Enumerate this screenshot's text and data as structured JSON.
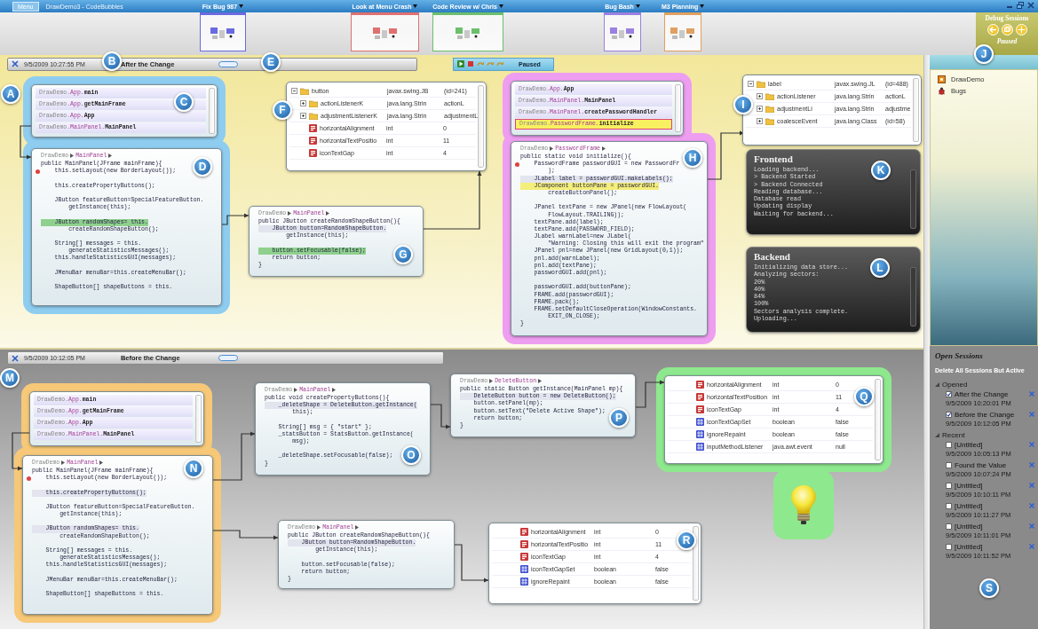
{
  "title_bar": {
    "menu_label": "Menu",
    "title": "DrawDemo3 - CodeBubbles"
  },
  "working_sets": [
    {
      "label": "Fix Bug 987",
      "color": "#6a6ae0"
    },
    {
      "label": "Look at Menu Crash",
      "color": "#e07070"
    },
    {
      "label": "Code Review w/ Chris",
      "color": "#6cbf6c"
    },
    {
      "label": "Bug Bash",
      "color": "#9a80e0"
    },
    {
      "label": "M3 Planning",
      "color": "#e0a060"
    }
  ],
  "debug_sessions": {
    "title": "Debug Sessions",
    "status": "Paused",
    "marker": "J"
  },
  "workspaces": [
    {
      "marker": "A",
      "session": {
        "date": "9/5/2009 10:27:55 PM",
        "title": "After the Change",
        "marker": "B",
        "handle_marker": "E"
      },
      "debug_toolbar": {
        "status": "Paused"
      },
      "groups": [
        {
          "color": "#8ecdf0",
          "bubbles": [
            {
              "kind": "stack",
              "marker": "C",
              "frames": [
                {
                  "package": "DrawDemo.",
                  "class": "App.",
                  "method": "main",
                  "selected": false
                },
                {
                  "package": "DrawDemo.",
                  "class": "App.",
                  "method": "getMainFrame",
                  "selected": false
                },
                {
                  "package": "DrawDemo.",
                  "class": "App.",
                  "method": "App",
                  "selected": false
                },
                {
                  "package": "DrawDemo.",
                  "class": "MainPanel.",
                  "method": "MainPanel",
                  "selected": false
                }
              ]
            },
            {
              "kind": "code",
              "marker": "D",
              "path": [
                "DrawDemo",
                "MainPanel"
              ],
              "blocks": [
                [
                  {
                    "text": "public MainPanel(JFrame mainFrame){",
                    "kind": "plain"
                  },
                  {
                    "text": "    this.setLayout(new BorderLayout());",
                    "kind": "breakpoint"
                  }
                ],
                [
                  {
                    "text": "    this.createPropertyButtons();",
                    "kind": "plain"
                  }
                ],
                [
                  {
                    "text": "    JButton featureButton=SpecialFeatureButton.",
                    "kind": "plain"
                  },
                  {
                    "text": "        getInstance(this);",
                    "kind": "plain"
                  }
                ],
                [
                  {
                    "text": "    JButton randomShapes= this.",
                    "kind": "current"
                  },
                  {
                    "text": "        createRandomShapeButton();",
                    "kind": "plain"
                  }
                ],
                [
                  {
                    "text": "    String[] messages = this.",
                    "kind": "plain"
                  },
                  {
                    "text": "        generateStatisticsMessages();",
                    "kind": "plain"
                  },
                  {
                    "text": "    this.handleStatisticsGUI(messages);",
                    "kind": "plain"
                  }
                ],
                [
                  {
                    "text": "    JMenuBar menuBar=this.createMenuBar();",
                    "kind": "plain"
                  }
                ],
                [
                  {
                    "text": "    ShapeButton[] shapeButtons = this.",
                    "kind": "plain"
                  }
                ]
              ]
            }
          ]
        },
        {
          "color": "#ee9ef0",
          "bubbles": [
            {
              "kind": "stack",
              "frames": [
                {
                  "package": "DrawDemo.",
                  "class": "App.",
                  "method": "App",
                  "selected": false
                },
                {
                  "package": "DrawDemo.",
                  "class": "MainPanel.",
                  "method": "MainPanel",
                  "selected": false
                },
                {
                  "package": "DrawDemo.",
                  "class": "MainPanel.",
                  "method": "createPasswordHandler",
                  "selected": false
                },
                {
                  "package": "DrawDemo.",
                  "class": "PasswordFrame.",
                  "method": "initialize",
                  "selected": true
                }
              ]
            },
            {
              "kind": "code",
              "marker": "H",
              "path": [
                "DrawDemo",
                "PasswordFrame"
              ],
              "blocks": [
                [
                  {
                    "text": "public static void initialize(){",
                    "kind": "plain"
                  },
                  {
                    "text": "    PasswordFrame passwordGUI = new PasswordFr",
                    "kind": "breakpoint"
                  },
                  {
                    "text": "        );",
                    "kind": "plain"
                  },
                  {
                    "text": "    JLabel label = passwordGUI.makeLabels();",
                    "kind": "hover"
                  },
                  {
                    "text": "    JComponent buttonPane = passwordGUI.",
                    "kind": "caller"
                  },
                  {
                    "text": "        createButtonPanel();",
                    "kind": "plain"
                  }
                ],
                [
                  {
                    "text": "    JPanel textPane = new JPanel(new FlowLayout(",
                    "kind": "plain"
                  },
                  {
                    "text": "        FlowLayout.TRAILING));",
                    "kind": "plain"
                  },
                  {
                    "text": "    textPane.add(label);",
                    "kind": "plain"
                  },
                  {
                    "text": "    textPane.add(PASSWORD_FIELD);",
                    "kind": "plain"
                  },
                  {
                    "text": "    JLabel warnLabel=new JLabel(",
                    "kind": "plain"
                  },
                  {
                    "text": "        \"Warning: Closing this will exit the program\"",
                    "kind": "plain"
                  },
                  {
                    "text": "    JPanel pnl=new JPanel(new GridLayout(0,1));",
                    "kind": "plain"
                  },
                  {
                    "text": "    pnl.add(warnLabel);",
                    "kind": "plain"
                  },
                  {
                    "text": "    pnl.add(textPane);",
                    "kind": "plain"
                  },
                  {
                    "text": "    passwordGUI.add(pnl);",
                    "kind": "plain"
                  }
                ],
                [
                  {
                    "text": "    passwordGUI.add(buttonPane);",
                    "kind": "plain"
                  },
                  {
                    "text": "    FRAME.add(passwordGUI);",
                    "kind": "plain"
                  },
                  {
                    "text": "    FRAME.pack();",
                    "kind": "plain"
                  },
                  {
                    "text": "    FRAME.setDefaultCloseOperation(WindowConstants.",
                    "kind": "plain"
                  },
                  {
                    "text": "        EXIT_ON_CLOSE);",
                    "kind": "plain"
                  },
                  {
                    "text": "}",
                    "kind": "plain"
                  }
                ]
              ]
            }
          ]
        }
      ],
      "bubbles": [
        {
          "kind": "variables",
          "marker": "F",
          "rows": [
            {
              "kind": "object",
              "name": "button",
              "type": "javax.swing.JB",
              "value": "(id=241)",
              "expanded": true,
              "children": [
                {
                  "kind": "object",
                  "name": "actionListenerK",
                  "type": "java.lang.Strin",
                  "value": "actionL",
                  "expanded": false
                },
                {
                  "kind": "object",
                  "name": "adjustmentListenerK",
                  "type": "java.lang.Strin",
                  "value": "adjustmentL",
                  "expanded": false
                },
                {
                  "kind": "int",
                  "name": "horizontalAlignment",
                  "type": "int",
                  "value": "0"
                },
                {
                  "kind": "int",
                  "name": "horizontalTextPositio",
                  "type": "int",
                  "value": "11"
                },
                {
                  "kind": "int",
                  "name": "iconTextGap",
                  "type": "int",
                  "value": "4"
                }
              ]
            }
          ]
        },
        {
          "kind": "code",
          "marker": "G",
          "path": [
            "DrawDemo",
            "MainPanel"
          ],
          "blocks": [
            [
              {
                "text": "public JButton createRandomShapeButton(){",
                "kind": "plain"
              },
              {
                "text": "    JButton button=RandomShapeButton.",
                "kind": "hover"
              },
              {
                "text": "        getInstance(this);",
                "kind": "plain"
              }
            ],
            [
              {
                "text": "    button.setFocusable(false);",
                "kind": "current"
              },
              {
                "text": "    return button;",
                "kind": "plain"
              },
              {
                "text": "}",
                "kind": "plain"
              }
            ]
          ]
        },
        {
          "kind": "variables",
          "marker": "I",
          "rows": [
            {
              "kind": "object",
              "name": "label",
              "type": "javax.swing.JL",
              "value": "(id=488)",
              "expanded": true,
              "children": [
                {
                  "kind": "object",
                  "name": "actionListener",
                  "type": "java.lang.Strin",
                  "value": "actionL",
                  "expanded": false
                },
                {
                  "kind": "object",
                  "name": "adjustmentLi",
                  "type": "java.lang.Strin",
                  "value": "adjustme",
                  "expanded": false
                },
                {
                  "kind": "object",
                  "name": "coalesceEvent",
                  "type": "java.lang.Class",
                  "value": "(id=58)",
                  "expanded": false
                }
              ]
            }
          ]
        },
        {
          "kind": "console",
          "marker": "K",
          "title": "Frontend",
          "lines": [
            "Loading backend...",
            "> Backend Started",
            "> Backend Connected",
            "Reading database...",
            "Database read",
            "Updating display",
            "Waiting for backend..."
          ]
        },
        {
          "kind": "console",
          "marker": "L",
          "title": "Backend",
          "lines": [
            "Initializing data store...",
            "Analyzing sectors:",
            "20%",
            "40%",
            "84%",
            "100%",
            "Sectors analysis complete.",
            "Uploading..."
          ]
        }
      ]
    },
    {
      "marker": "M",
      "session": {
        "date": "9/5/2009 10:12:05 PM",
        "title": "Before the Change"
      },
      "groups": [
        {
          "color": "#f6c878",
          "bubbles": [
            {
              "kind": "stack",
              "frames": [
                {
                  "package": "DrawDemo.",
                  "class": "App.",
                  "method": "main",
                  "selected": false
                },
                {
                  "package": "DrawDemo.",
                  "class": "App.",
                  "method": "getMainFrame",
                  "selected": false
                },
                {
                  "package": "DrawDemo.",
                  "class": "App.",
                  "method": "App",
                  "selected": false
                },
                {
                  "package": "DrawDemo.",
                  "class": "MainPanel.",
                  "method": "MainPanel",
                  "selected": false
                }
              ]
            },
            {
              "kind": "code",
              "marker": "N",
              "path": [
                "DrawDemo",
                "MainPanel"
              ],
              "blocks": [
                [
                  {
                    "text": "public MainPanel(JFrame mainFrame){",
                    "kind": "plain"
                  },
                  {
                    "text": "    this.setLayout(new BorderLayout());",
                    "kind": "breakpoint"
                  }
                ],
                [
                  {
                    "text": "    this.createPropertyButtons();",
                    "kind": "hover"
                  }
                ],
                [
                  {
                    "text": "    JButton featureButton=SpecialFeatureButton.",
                    "kind": "plain"
                  },
                  {
                    "text": "        getInstance(this);",
                    "kind": "plain"
                  }
                ],
                [
                  {
                    "text": "    JButton randomShapes= this.",
                    "kind": "hover"
                  },
                  {
                    "text": "        createRandomShapeButton();",
                    "kind": "plain"
                  }
                ],
                [
                  {
                    "text": "    String[] messages = this.",
                    "kind": "plain"
                  },
                  {
                    "text": "        generateStatisticsMessages();",
                    "kind": "plain"
                  },
                  {
                    "text": "    this.handleStatisticsGUI(messages);",
                    "kind": "plain"
                  }
                ],
                [
                  {
                    "text": "    JMenuBar menuBar=this.createMenuBar();",
                    "kind": "plain"
                  }
                ],
                [
                  {
                    "text": "    ShapeButton[] shapeButtons = this.",
                    "kind": "plain"
                  }
                ]
              ]
            }
          ]
        },
        {
          "color": "#8ee88e",
          "bubbles": [
            {
              "kind": "variables",
              "marker": "Q",
              "rows": [
                {
                  "kind": "int",
                  "name": "horizontalAlignment",
                  "type": "int",
                  "value": "0"
                },
                {
                  "kind": "int",
                  "name": "horizontalTextPosition",
                  "type": "int",
                  "value": "11"
                },
                {
                  "kind": "int",
                  "name": "iconTextGap",
                  "type": "int",
                  "value": "4"
                },
                {
                  "kind": "bool",
                  "name": "iconTextGapSet",
                  "type": "boolean",
                  "value": "false"
                },
                {
                  "kind": "bool",
                  "name": "ignoreRepaint",
                  "type": "boolean",
                  "value": "false"
                },
                {
                  "kind": "bool",
                  "name": "inputMethodListener",
                  "type": "java.awt.event",
                  "value": "null"
                }
              ]
            },
            {
              "kind": "idea"
            }
          ]
        }
      ],
      "bubbles": [
        {
          "kind": "code",
          "marker": "O",
          "path": [
            "DrawDemo",
            "MainPanel"
          ],
          "blocks": [
            [
              {
                "text": "public void createPropertyButtons(){",
                "kind": "plain"
              },
              {
                "text": "    _deleteShape = DeleteButton.getInstance(",
                "kind": "hover"
              },
              {
                "text": "        this);",
                "kind": "plain"
              }
            ],
            [
              {
                "text": "    String[] msg = { \"start\" };",
                "kind": "plain"
              },
              {
                "text": "    _statsButton = StatsButton.getInstance(",
                "kind": "plain"
              },
              {
                "text": "        msg);",
                "kind": "plain"
              }
            ],
            [
              {
                "text": "    _deleteShape.setFocusable(false);",
                "kind": "plain"
              },
              {
                "text": "}",
                "kind": "plain"
              }
            ]
          ]
        },
        {
          "kind": "code",
          "marker": "P",
          "path": [
            "DrawDemo",
            "DeleteButton"
          ],
          "blocks": [
            [
              {
                "text": "public static Button getInstance(MainPanel mp){",
                "kind": "plain"
              },
              {
                "text": "    DeleteButton button = new DeleteButton();",
                "kind": "hover"
              },
              {
                "text": "    button.setPanel(mp);",
                "kind": "plain"
              },
              {
                "text": "    button.setText(\"Delete Active Shape\");",
                "kind": "plain"
              },
              {
                "text": "    return button;",
                "kind": "plain"
              },
              {
                "text": "}",
                "kind": "plain"
              }
            ]
          ]
        },
        {
          "kind": "code",
          "path": [
            "DrawDemo",
            "MainPanel"
          ],
          "blocks": [
            [
              {
                "text": "public JButton createRandomShapeButton(){",
                "kind": "plain"
              },
              {
                "text": "    JButton button=RandomShapeButton.",
                "kind": "hover"
              },
              {
                "text": "        getInstance(this);",
                "kind": "plain"
              }
            ],
            [
              {
                "text": "    button.setFocusable(false);",
                "kind": "plain"
              },
              {
                "text": "    return button;",
                "kind": "plain"
              },
              {
                "text": "}",
                "kind": "plain"
              }
            ]
          ]
        },
        {
          "kind": "variables",
          "marker": "R",
          "rows": [
            {
              "kind": "int",
              "name": "horizontalAlignment",
              "type": "int",
              "value": "0"
            },
            {
              "kind": "int",
              "name": "horizontalTextPositio",
              "type": "int",
              "value": "11"
            },
            {
              "kind": "int",
              "name": "iconTextGap",
              "type": "int",
              "value": "4"
            },
            {
              "kind": "bool",
              "name": "iconTextGapSet",
              "type": "boolean",
              "value": "false"
            },
            {
              "kind": "bool",
              "name": "ignoreRepaint",
              "type": "boolean",
              "value": "false"
            }
          ]
        }
      ]
    }
  ],
  "sidebar": {
    "items": [
      {
        "label": "DrawDemo",
        "kind": "project"
      },
      {
        "label": "Bugs",
        "kind": "bug"
      }
    ],
    "title": "Open Sessions",
    "action": "Delete All Sessions But Active",
    "marker": "S",
    "session_groups": [
      {
        "label": "Opened",
        "expanded": true,
        "sessions": [
          {
            "name": "After the Change",
            "date": "9/5/2009 10:20:01 PM",
            "checked": true
          },
          {
            "name": "Before the Change",
            "date": "9/5/2009 10:12:05 PM",
            "checked": true
          }
        ]
      },
      {
        "label": "Recent",
        "expanded": true,
        "sessions": [
          {
            "name": "[Untitled]",
            "date": "9/5/2009 10:05:13 PM",
            "checked": false
          },
          {
            "name": "Found the Value",
            "date": "9/5/2009 10:07:24 PM",
            "checked": false
          },
          {
            "name": "[Untitled]",
            "date": "9/5/2009 10:10:11 PM",
            "checked": false
          },
          {
            "name": "[Untitled]",
            "date": "9/5/2009 10:11:27 PM",
            "checked": false
          },
          {
            "name": "[Untitled]",
            "date": "9/5/2009 10:11:01 PM",
            "checked": false
          },
          {
            "name": "[Untitled]",
            "date": "9/5/2009 10:11:52 PM",
            "checked": false
          }
        ]
      }
    ]
  }
}
